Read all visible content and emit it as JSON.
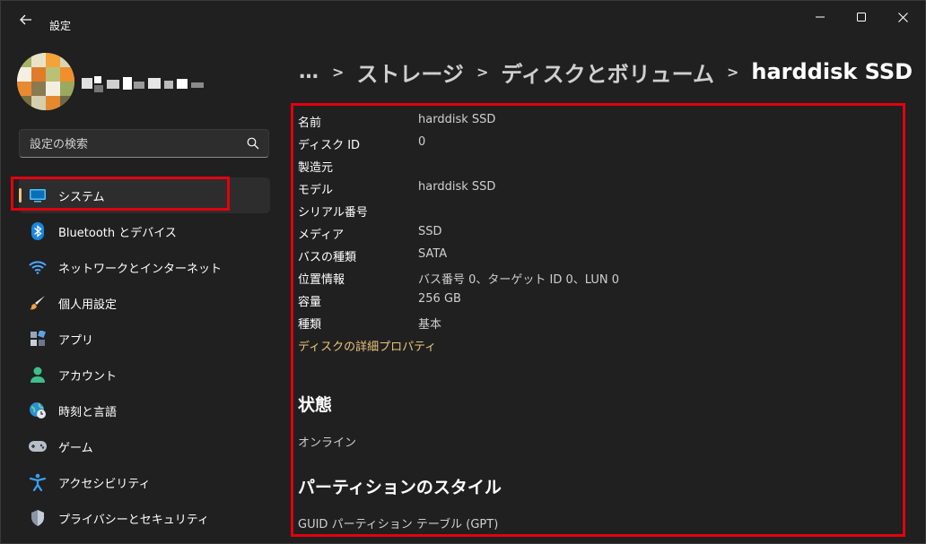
{
  "window": {
    "title": "設定"
  },
  "user": {
    "name": ""
  },
  "search": {
    "placeholder": "設定の検索"
  },
  "sidebar": {
    "items": [
      {
        "label": "システム",
        "icon": "system-icon",
        "selected": true
      },
      {
        "label": "Bluetooth とデバイス",
        "icon": "bluetooth-icon"
      },
      {
        "label": "ネットワークとインターネット",
        "icon": "wifi-icon"
      },
      {
        "label": "個人用設定",
        "icon": "brush-icon"
      },
      {
        "label": "アプリ",
        "icon": "apps-icon"
      },
      {
        "label": "アカウント",
        "icon": "person-icon"
      },
      {
        "label": "時刻と言語",
        "icon": "globe-clock-icon"
      },
      {
        "label": "ゲーム",
        "icon": "gamepad-icon"
      },
      {
        "label": "アクセシビリティ",
        "icon": "accessibility-icon"
      },
      {
        "label": "プライバシーとセキュリティ",
        "icon": "shield-icon"
      }
    ]
  },
  "breadcrumb": {
    "more": "…",
    "items": [
      "ストレージ",
      "ディスクとボリューム"
    ],
    "current": "harddisk SSD"
  },
  "properties": [
    {
      "label": "名前",
      "value": "harddisk SSD"
    },
    {
      "label": "ディスク ID",
      "value": "0"
    },
    {
      "label": "製造元",
      "value": ""
    },
    {
      "label": "モデル",
      "value": "harddisk SSD"
    },
    {
      "label": "シリアル番号",
      "value": ""
    },
    {
      "label": "メディア",
      "value": "SSD"
    },
    {
      "label": "バスの種類",
      "value": "SATA"
    },
    {
      "label": "位置情報",
      "value": "バス番号 0、ターゲット ID 0、LUN 0"
    },
    {
      "label": "容量",
      "value": "256 GB"
    },
    {
      "label": "種類",
      "value": "基本"
    }
  ],
  "advanced_link": "ディスクの詳細プロパティ",
  "status": {
    "title": "状態",
    "value": "オンライン"
  },
  "partition": {
    "title": "パーティションのスタイル",
    "value": "GUID パーティション テーブル (GPT)"
  },
  "colors": {
    "accent": "#e8c57a",
    "highlight": "#e3000f",
    "background": "#202020"
  }
}
